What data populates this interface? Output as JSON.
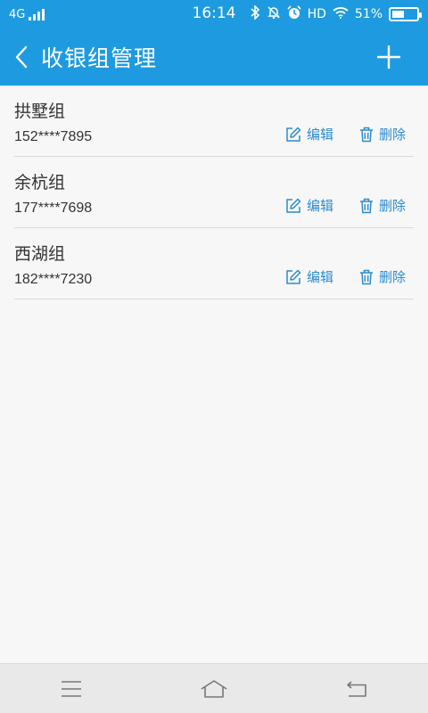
{
  "status_bar": {
    "network": "4G",
    "time": "16:14",
    "hd": "HD",
    "battery_percent": "51%",
    "battery_level": 0.51,
    "icons": [
      "bluetooth-icon",
      "silent-icon",
      "alarm-icon",
      "wifi-icon"
    ]
  },
  "header": {
    "title": "收银组管理",
    "back_icon": "chevron-left-icon",
    "add_icon": "plus-icon"
  },
  "colors": {
    "header_bg": "#1e9be0",
    "action_text": "#2a8ccf"
  },
  "groups": [
    {
      "name": "拱墅组",
      "phone": "152****7895",
      "edit_label": "编辑",
      "delete_label": "删除"
    },
    {
      "name": "余杭组",
      "phone": "177****7698",
      "edit_label": "编辑",
      "delete_label": "删除"
    },
    {
      "name": "西湖组",
      "phone": "182****7230",
      "edit_label": "编辑",
      "delete_label": "删除"
    }
  ],
  "nav_bar": {
    "icons": [
      "menu-icon",
      "home-icon",
      "back-icon"
    ]
  }
}
